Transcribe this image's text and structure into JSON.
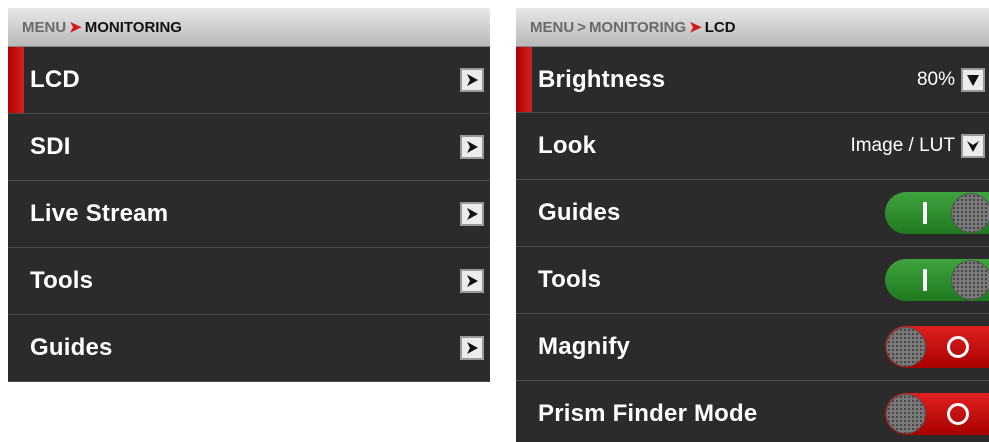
{
  "left": {
    "breadcrumb": {
      "root": "MENU",
      "current": "MONITORING"
    },
    "items": [
      {
        "label": "LCD",
        "selected": true
      },
      {
        "label": "SDI"
      },
      {
        "label": "Live Stream"
      },
      {
        "label": "Tools"
      },
      {
        "label": "Guides"
      }
    ]
  },
  "right": {
    "breadcrumb": {
      "root": "MENU",
      "middle": "MONITORING",
      "current": "LCD"
    },
    "items": [
      {
        "label": "Brightness",
        "value": "80%",
        "control": "dropdown",
        "selected": true
      },
      {
        "label": "Look",
        "value": "Image / LUT",
        "control": "dropdown"
      },
      {
        "label": "Guides",
        "control": "toggle",
        "state": "on"
      },
      {
        "label": "Tools",
        "control": "toggle",
        "state": "on"
      },
      {
        "label": "Magnify",
        "control": "toggle",
        "state": "off"
      },
      {
        "label": "Prism Finder Mode",
        "control": "toggle",
        "state": "off"
      }
    ]
  },
  "colors": {
    "accent_red": "#d41818",
    "toggle_on": "#2e8f2e",
    "toggle_off": "#c81010",
    "panel_bg": "#2b2b2b"
  }
}
